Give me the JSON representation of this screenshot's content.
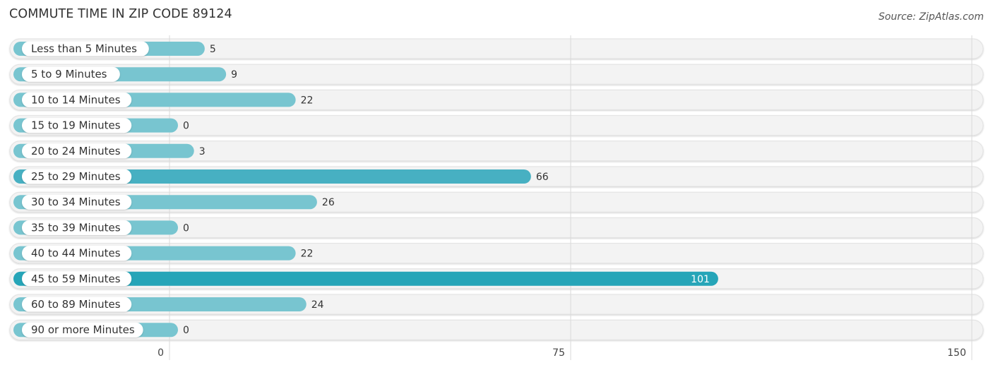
{
  "header": {
    "title": "COMMUTE TIME IN ZIP CODE 89124",
    "source": "Source: ZipAtlas.com"
  },
  "colors": {
    "bar_normal": "#78c5d0",
    "bar_highlight_mid": "#47b0c2",
    "bar_highlight_max": "#26a5b8",
    "track": "#f3f3f3",
    "grid": "#d9d9d9"
  },
  "chart_data": {
    "type": "bar",
    "orientation": "horizontal",
    "title": "COMMUTE TIME IN ZIP CODE 89124",
    "xlabel": "",
    "ylabel": "",
    "xlim": [
      0,
      150
    ],
    "xticks": [
      0,
      75,
      150
    ],
    "xtick_labels": [
      "0",
      "75",
      "150"
    ],
    "grid": true,
    "categories": [
      "Less than 5 Minutes",
      "5 to 9 Minutes",
      "10 to 14 Minutes",
      "15 to 19 Minutes",
      "20 to 24 Minutes",
      "25 to 29 Minutes",
      "30 to 34 Minutes",
      "35 to 39 Minutes",
      "40 to 44 Minutes",
      "45 to 59 Minutes",
      "60 to 89 Minutes",
      "90 or more Minutes"
    ],
    "values": [
      5,
      9,
      22,
      0,
      3,
      66,
      26,
      0,
      22,
      101,
      24,
      0
    ],
    "value_labels": [
      "5",
      "9",
      "22",
      "0",
      "3",
      "66",
      "26",
      "0",
      "22",
      "101",
      "24",
      "0"
    ]
  }
}
